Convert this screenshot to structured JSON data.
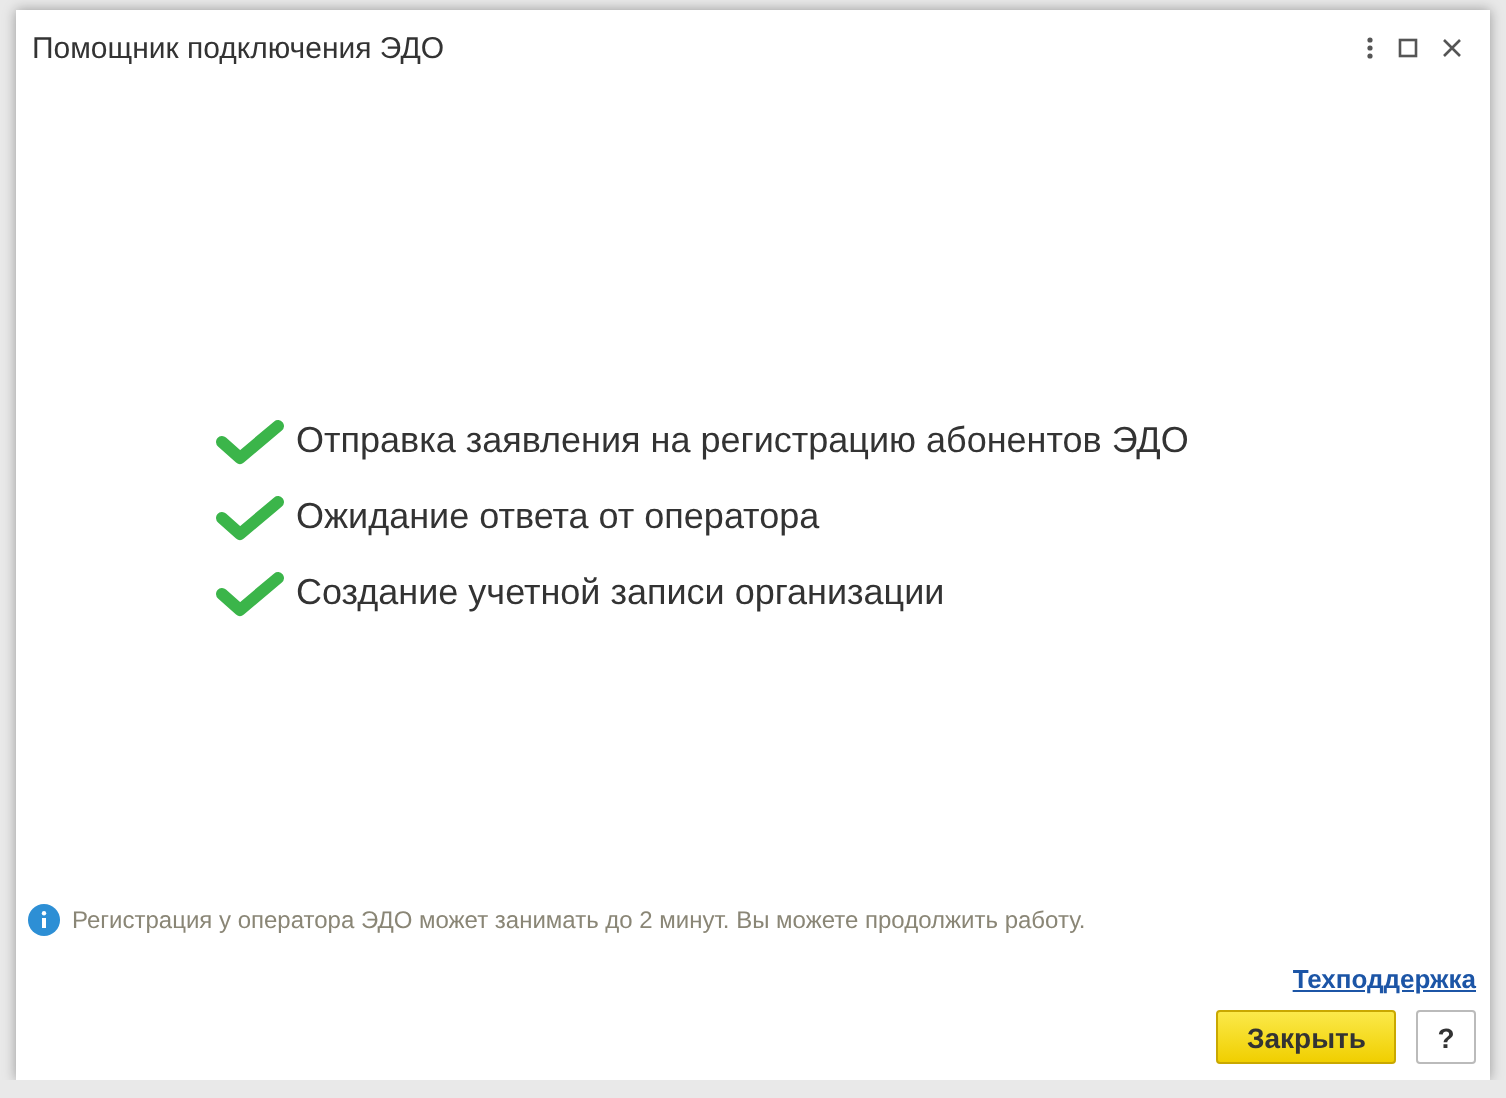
{
  "window": {
    "title": "Помощник подключения ЭДО"
  },
  "steps": [
    {
      "label": "Отправка заявления на регистрацию абонентов ЭДО",
      "done": true
    },
    {
      "label": "Ожидание ответа от оператора",
      "done": true
    },
    {
      "label": "Создание учетной записи организации",
      "done": true
    }
  ],
  "info": "Регистрация у оператора ЭДО может занимать до 2 минут. Вы можете продолжить работу.",
  "support_link": "Техподдержка",
  "buttons": {
    "close": "Закрыть",
    "help": "?"
  }
}
